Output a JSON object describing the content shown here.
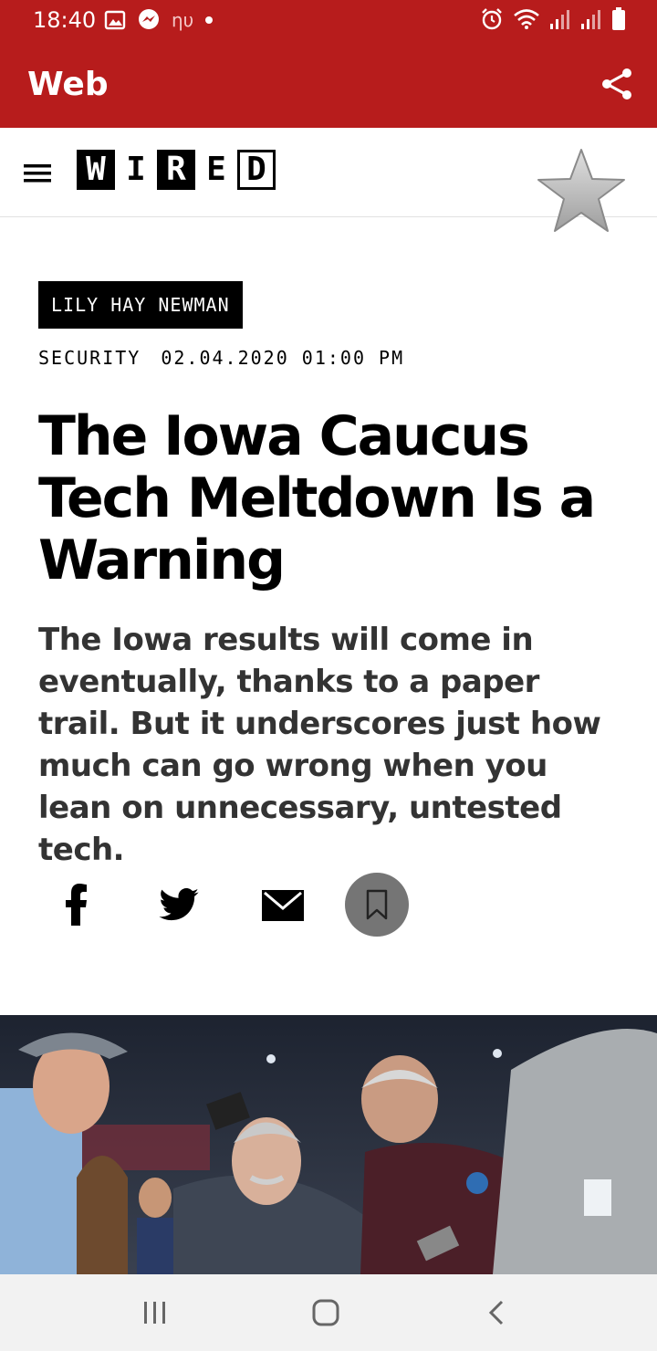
{
  "status_bar": {
    "time": "18:40",
    "carrier_glyph": "ηυ",
    "left_icons": [
      "image-icon",
      "messenger-icon",
      "carrier-icon",
      "dot-icon"
    ],
    "right_icons": [
      "alarm-icon",
      "wifi-icon",
      "signal-icon",
      "signal-icon-2",
      "battery-icon"
    ]
  },
  "app_bar": {
    "title": "Web",
    "share_icon": "share-icon",
    "color": "#b71c1c"
  },
  "site_header": {
    "menu_icon": "hamburger-menu-icon",
    "logo_letters": [
      "W",
      "I",
      "R",
      "E",
      "D"
    ],
    "favorite_icon": "star-icon"
  },
  "article": {
    "author": "LILY HAY NEWMAN",
    "section": "SECURITY",
    "date": "02.04.2020 01:00 PM",
    "headline": "The Iowa Caucus Tech Meltdown Is a Warning",
    "dek": "The Iowa results will come in eventually, thanks to a paper trail. But it underscores just how much can go wrong when you lean on unnecessary, untested tech."
  },
  "share_buttons": {
    "facebook_icon": "facebook-icon",
    "twitter_icon": "twitter-icon",
    "email_icon": "email-icon",
    "bookmark_icon": "bookmark-icon"
  },
  "photo": {
    "subject": "caucus-photo"
  },
  "nav_bar": {
    "recents_icon": "recents-icon",
    "home_icon": "home-icon",
    "back_icon": "back-icon"
  }
}
